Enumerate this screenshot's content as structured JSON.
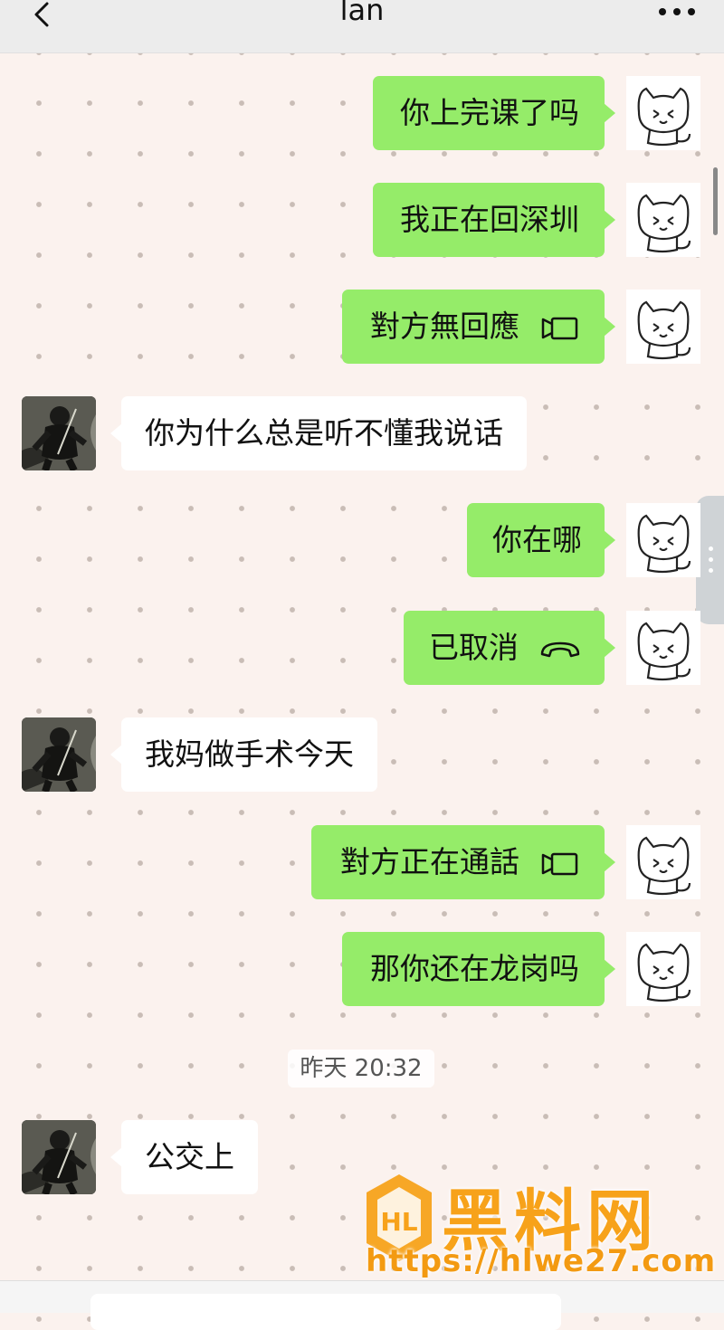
{
  "header": {
    "title": "lan",
    "back_icon": "chevron-left-icon",
    "more_icon": "more-dots-icon"
  },
  "messages": [
    {
      "side": "me",
      "text": "你上完课了吗"
    },
    {
      "side": "me",
      "text": "我正在回深圳"
    },
    {
      "side": "me",
      "text": "對方無回應",
      "icon": "video-call-icon"
    },
    {
      "side": "them",
      "text": "你为什么总是听不懂我说话"
    },
    {
      "side": "me",
      "text": "你在哪"
    },
    {
      "side": "me",
      "text": "已取消",
      "icon": "phone-hangup-icon"
    },
    {
      "side": "them",
      "text": "我妈做手术今天"
    },
    {
      "side": "me",
      "text": "對方正在通話",
      "icon": "video-call-icon"
    },
    {
      "side": "me",
      "text": "那你还在龙岗吗"
    },
    {
      "side": "them",
      "text": "公交上"
    }
  ],
  "timestamp": "昨天 20:32",
  "watermark": {
    "brand": "黑料网",
    "url": "https://hlwe27.com",
    "color": "#f7a21a"
  },
  "colors": {
    "my_bubble": "#95ec69",
    "their_bubble": "#ffffff",
    "background": "#fbf2ee"
  }
}
